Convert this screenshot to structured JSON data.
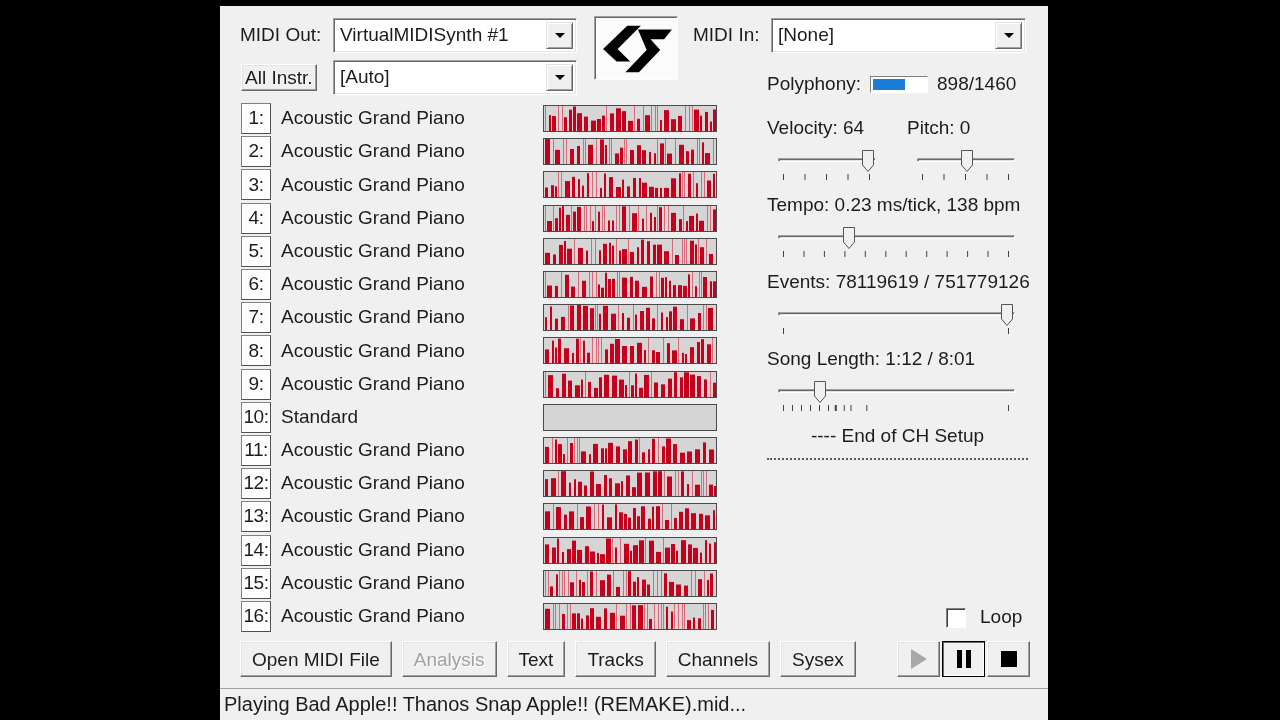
{
  "midi_out": {
    "label": "MIDI Out:",
    "value": "VirtualMIDISynth #1"
  },
  "instrument_mode": {
    "button": "All Instr.",
    "value": "[Auto]"
  },
  "midi_in": {
    "label": "MIDI In:",
    "value": "[None]"
  },
  "polyphony": {
    "label": "Polyphony:",
    "level": 0.615,
    "reading": "898/1460"
  },
  "channels": [
    {
      "number": "1:",
      "instrument": "Acoustic Grand Piano",
      "active": true
    },
    {
      "number": "2:",
      "instrument": "Acoustic Grand Piano",
      "active": true
    },
    {
      "number": "3:",
      "instrument": "Acoustic Grand Piano",
      "active": true
    },
    {
      "number": "4:",
      "instrument": "Acoustic Grand Piano",
      "active": true
    },
    {
      "number": "5:",
      "instrument": "Acoustic Grand Piano",
      "active": true
    },
    {
      "number": "6:",
      "instrument": "Acoustic Grand Piano",
      "active": true
    },
    {
      "number": "7:",
      "instrument": "Acoustic Grand Piano",
      "active": true
    },
    {
      "number": "8:",
      "instrument": "Acoustic Grand Piano",
      "active": true
    },
    {
      "number": "9:",
      "instrument": "Acoustic Grand Piano",
      "active": true
    },
    {
      "number": "10:",
      "instrument": "Standard",
      "active": false
    },
    {
      "number": "11:",
      "instrument": "Acoustic Grand Piano",
      "active": true
    },
    {
      "number": "12:",
      "instrument": "Acoustic Grand Piano",
      "active": true
    },
    {
      "number": "13:",
      "instrument": "Acoustic Grand Piano",
      "active": true
    },
    {
      "number": "14:",
      "instrument": "Acoustic Grand Piano",
      "active": true
    },
    {
      "number": "15:",
      "instrument": "Acoustic Grand Piano",
      "active": true
    },
    {
      "number": "16:",
      "instrument": "Acoustic Grand Piano",
      "active": true
    }
  ],
  "slider_rows": [
    [
      {
        "label": "Velocity: 64",
        "level": 1
      },
      {
        "label": "Pitch: 0",
        "level": 0.52
      }
    ],
    [
      {
        "label": "Tempo: 0.23 ms/tick, 138 bpm",
        "level": 0.29
      }
    ],
    [
      {
        "label": "Events: 78119619 / 751779126",
        "level": 1
      }
    ],
    [
      {
        "label": "Song Length: 1:12 / 8:01",
        "level": 0.16
      }
    ]
  ],
  "log": [
    "---- End of CH Setup"
  ],
  "loop": {
    "label": "Loop",
    "checked": false
  },
  "buttons": [
    {
      "label": "Open MIDI File",
      "disabled": false
    },
    {
      "label": "Analysis",
      "disabled": true
    },
    {
      "label": "Text",
      "disabled": false
    },
    {
      "label": "Tracks",
      "disabled": false
    },
    {
      "label": "Channels",
      "disabled": false
    },
    {
      "label": "Sysex",
      "disabled": false
    }
  ],
  "transport": [
    {
      "kind": "play",
      "disabled": true,
      "pressed": false
    },
    {
      "kind": "pause",
      "disabled": false,
      "pressed": true
    },
    {
      "kind": "stop",
      "disabled": false,
      "pressed": false
    }
  ],
  "status_bar": {
    "text": "Playing Bad Apple!! Thanos Snap Apple!! (REMAKE).mid..."
  }
}
